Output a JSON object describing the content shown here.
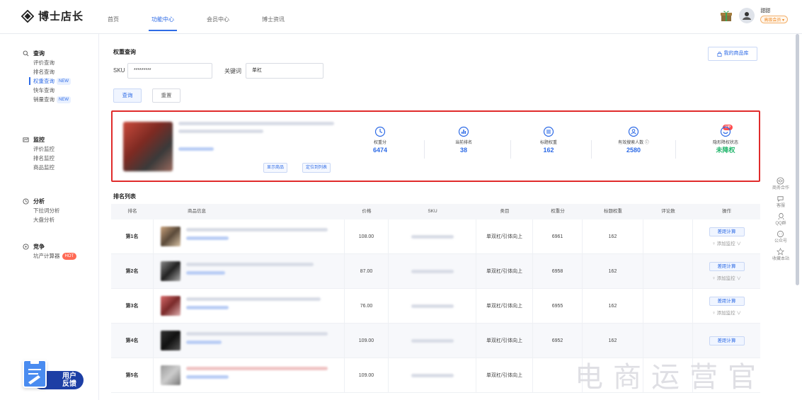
{
  "brand": {
    "name": "博士店长"
  },
  "nav": {
    "items": [
      "首页",
      "功能中心",
      "会员中心",
      "博士资讯"
    ]
  },
  "user": {
    "name": "甜甜",
    "badge": "高级会员 ▾"
  },
  "sidebar": {
    "groups": [
      {
        "title": "查询",
        "items": [
          {
            "label": "评价查询",
            "tag": ""
          },
          {
            "label": "排名查询",
            "tag": ""
          },
          {
            "label": "权重查询",
            "tag": "NEW"
          },
          {
            "label": "快车查询",
            "tag": ""
          },
          {
            "label": "销量查询",
            "tag": "NEW"
          }
        ]
      },
      {
        "title": "监控",
        "items": [
          {
            "label": "评价监控",
            "tag": ""
          },
          {
            "label": "排名监控",
            "tag": ""
          },
          {
            "label": "商品监控",
            "tag": ""
          }
        ]
      },
      {
        "title": "分析",
        "items": [
          {
            "label": "下拉词分析",
            "tag": ""
          },
          {
            "label": "大盘分析",
            "tag": ""
          }
        ]
      },
      {
        "title": "竞争",
        "items": [
          {
            "label": "坑产计算器",
            "tag": "HOT"
          }
        ]
      }
    ]
  },
  "feedback": {
    "line1": "用户",
    "line2": "反馈"
  },
  "query": {
    "title": "权重查询",
    "sku_label": "SKU",
    "sku_value": "*********",
    "keyword_label": "关键词",
    "keyword_value": "单杠",
    "search_btn": "查询",
    "reset_btn": "重置",
    "library_btn": "我的商品库"
  },
  "product": {
    "show_btn": "显示商品",
    "locate_btn": "定位到列表",
    "stats": [
      {
        "label": "权重分",
        "value": "6474",
        "icon": "clock-icon"
      },
      {
        "label": "当前排名",
        "value": "38",
        "icon": "chart-icon"
      },
      {
        "label": "标题权重",
        "value": "162",
        "icon": "list-icon"
      },
      {
        "label": "有效搜索人数 ⓘ",
        "value": "2580",
        "icon": "users-icon"
      },
      {
        "label": "隐形降权状态",
        "value": "未降权",
        "icon": "shield-icon",
        "vip": "VIP"
      }
    ]
  },
  "ranking": {
    "title": "排名列表",
    "headers": [
      "排名",
      "商品信息",
      "价格",
      "SKU",
      "类目",
      "权重分",
      "标题权重",
      "评论数",
      "操作"
    ],
    "rows": [
      {
        "rank": "第1名",
        "price": "108.00",
        "category": "单双杠/引体向上",
        "weight": "6961",
        "title_weight": "162"
      },
      {
        "rank": "第2名",
        "price": "87.00",
        "category": "单双杠/引体向上",
        "weight": "6958",
        "title_weight": "162"
      },
      {
        "rank": "第3名",
        "price": "76.00",
        "category": "单双杠/引体向上",
        "weight": "6955",
        "title_weight": "162"
      },
      {
        "rank": "第4名",
        "price": "109.00",
        "category": "单双杠/引体向上",
        "weight": "6952",
        "title_weight": "162"
      },
      {
        "rank": "第5名",
        "price": "109.00",
        "category": "单双杠/引体向上",
        "weight": "",
        "title_weight": ""
      }
    ],
    "op_btn": "差距计算",
    "op_monitor": "♀ 添加监控 ∨"
  },
  "float_bar": {
    "items": [
      "商务合作",
      "客服",
      "QQ群",
      "公众号",
      "收藏本站"
    ]
  },
  "watermark": "电商运营官"
}
